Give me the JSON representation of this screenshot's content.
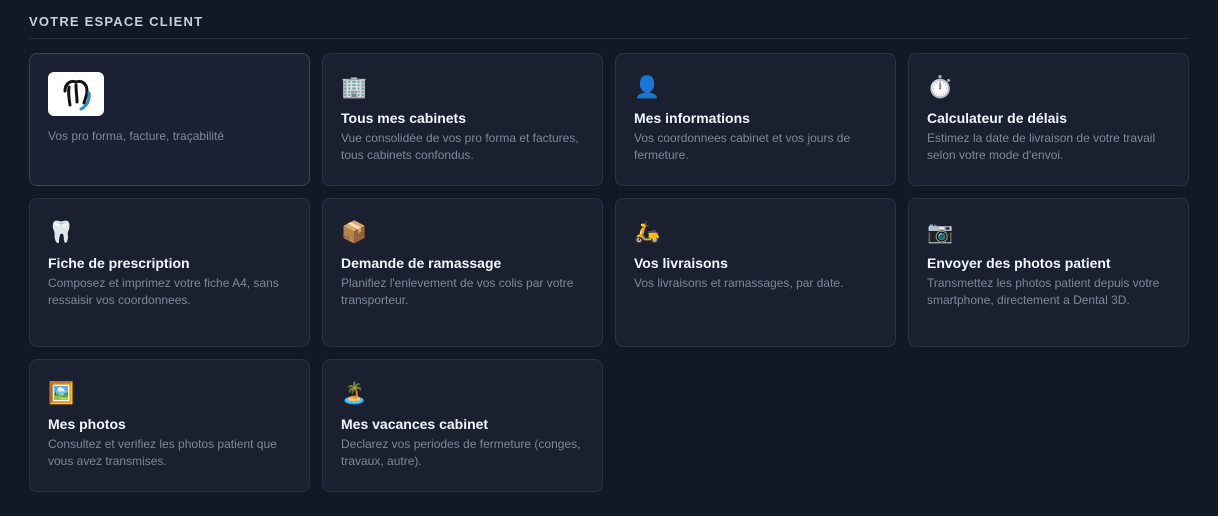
{
  "section": {
    "title": "VOTRE ESPACE CLIENT"
  },
  "cards": [
    {
      "icon": "dental-lab-logo",
      "title": "",
      "description": "Vos pro forma, facture, traçabilité"
    },
    {
      "icon": "🏢",
      "title": "Tous mes cabinets",
      "description": "Vue consolidée de vos pro forma et factures, tous cabinets confondus."
    },
    {
      "icon": "👤",
      "title": "Mes informations",
      "description": "Vos coordonnees cabinet et vos jours de fermeture."
    },
    {
      "icon": "⏱️",
      "title": "Calculateur de délais",
      "description": "Estimez la date de livraison de votre travail selon votre mode d'envoi."
    },
    {
      "icon": "🦷",
      "title": "Fiche de prescription",
      "description": "Composez et imprimez votre fiche A4, sans ressaisir vos coordonnees."
    },
    {
      "icon": "📦",
      "title": "Demande de ramassage",
      "description": "Planifiez l'enlevement de vos colis par votre transporteur."
    },
    {
      "icon": "🛵",
      "title": "Vos livraisons",
      "description": "Vos livraisons et ramassages, par date."
    },
    {
      "icon": "📷",
      "title": "Envoyer des photos patient",
      "description": "Transmettez les photos patient depuis votre smartphone, directement a Dental 3D."
    },
    {
      "icon": "🖼️",
      "title": "Mes photos",
      "description": "Consultez et verifiez les photos patient que vous avez transmises."
    },
    {
      "icon": "🏝️",
      "title": "Mes vacances cabinet",
      "description": "Declarez vos periodes de fermeture (conges, travaux, autre)."
    }
  ],
  "colors": {
    "background": "#131827",
    "card": "#1a2030",
    "card_border": "#293145",
    "title": "#f3f5f9",
    "description": "#7f879a",
    "logo_stroke": "#111111",
    "logo_accent": "#2a8fc7"
  }
}
